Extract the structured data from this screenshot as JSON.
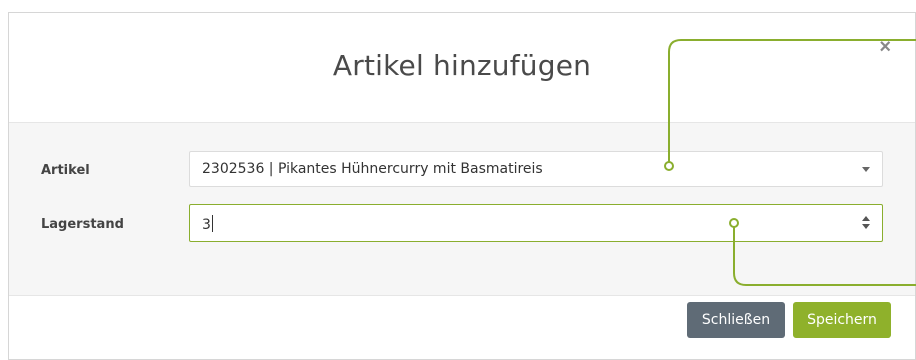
{
  "modal": {
    "title": "Artikel hinzufügen",
    "close_glyph": "×"
  },
  "form": {
    "article": {
      "label": "Artikel",
      "selected_value": "2302536 | Pikantes Hühnercurry mit Basmatireis"
    },
    "stock": {
      "label": "Lagerstand",
      "value": "3"
    }
  },
  "footer": {
    "close_label": "Schließen",
    "save_label": "Speichern"
  },
  "colors": {
    "accent": "#8fb12b",
    "secondary_button": "#5f6b76",
    "annotation": "#8aae2e"
  },
  "icons": {
    "close": "close-icon",
    "dropdown": "chevron-down-icon",
    "spinner": "spinner-icon"
  }
}
